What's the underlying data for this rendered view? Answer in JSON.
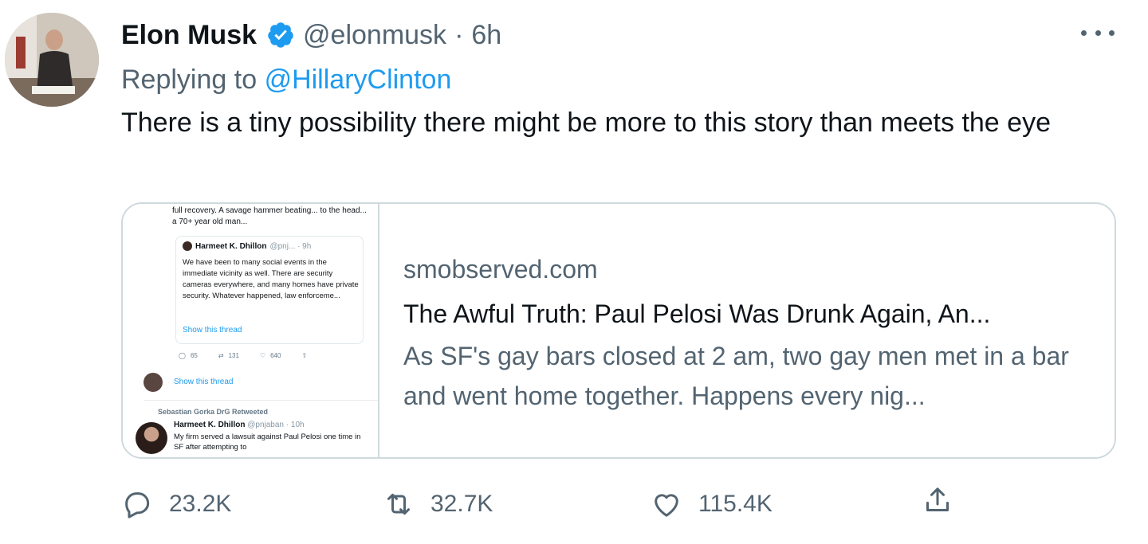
{
  "tweet": {
    "author": {
      "display_name": "Elon Musk",
      "handle": "@elonmusk",
      "separator": "·",
      "time": "6h"
    },
    "reply": {
      "prefix": "Replying to",
      "to": "@HillaryClinton"
    },
    "text": "There is a tiny possibility there might be more to this story than meets the eye",
    "card": {
      "domain": "smobserved.com",
      "title": "The Awful Truth: Paul Pelosi Was Drunk Again, An...",
      "description": "As SF's gay bars closed at 2 am, two gay men met in a bar and went home together. Happens every nig...",
      "thumbnail": {
        "top_text": "full recovery. A savage hammer beating... to the head... a 70+ year old man...",
        "quote_name": "Harmeet K. Dhillon",
        "quote_meta": "@pnj... · 9h",
        "quote_text": "We have been to many social events in the immediate vicinity as well. There are security cameras everywhere, and many homes have private security. Whatever happened, law enforceme...",
        "quote_link": "Show this thread",
        "reply_count": "65",
        "retweet_count": "131",
        "like_count": "640",
        "thread_link": "Show this thread",
        "retweeted_by": "Sebastian Gorka DrG Retweeted",
        "second_name": "Harmeet K. Dhillon",
        "second_meta": "@pnjaban · 10h",
        "second_text": "My firm served a lawsuit against Paul Pelosi one time in SF after attempting to"
      }
    },
    "stats": {
      "replies": "23.2K",
      "retweets": "32.7K",
      "likes": "115.4K"
    }
  },
  "colors": {
    "accent": "#1d9bf0",
    "secondary_text": "#536471",
    "border": "#cfd9de"
  },
  "icons": [
    "verified-badge-icon",
    "more-icon",
    "reply-icon",
    "retweet-icon",
    "like-icon",
    "share-icon"
  ]
}
